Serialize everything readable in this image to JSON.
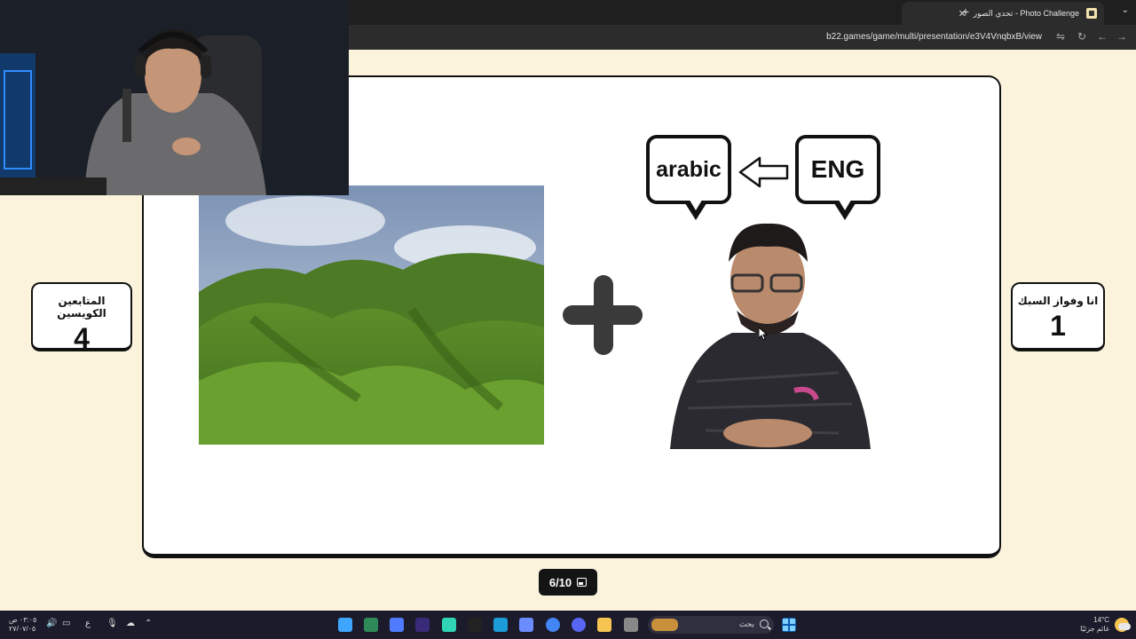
{
  "browser": {
    "tab_title": "تحدي الصور - Photo Challenge",
    "new_tab_symbol": "+",
    "close_symbol": "✕",
    "tabs_menu_symbol": "⌄",
    "url": "b22.games/game/multi/presentation/e3V4VnqbxB/view",
    "nav": {
      "back": "←",
      "forward": "→",
      "reload": "↻",
      "settings": "⇋"
    }
  },
  "game": {
    "bubble_left": "arabic",
    "bubble_right": "ENG",
    "page_indicator": "6/10",
    "teams": [
      {
        "name": "المتابعين الكويسين",
        "score": "4"
      },
      {
        "name": "انا وفواز السبك",
        "score": "1"
      }
    ]
  },
  "taskbar": {
    "search_label": "بحث",
    "weather_temp": "14°C",
    "weather_desc": "غائم جزئيًا",
    "clock_time": "٠٣:٠٥ ص",
    "clock_date": "٢٧/٠٧/٠٥",
    "lang": "ع",
    "colors": [
      "#3ea6ff",
      "#2f8a5a",
      "#4f7cff",
      "#3a2a7a",
      "#2fd5b5",
      "#222222",
      "#1b9bd7",
      "#6b8cff",
      "#4285f4",
      "#5865f2",
      "#f5c451",
      "#888888"
    ]
  }
}
